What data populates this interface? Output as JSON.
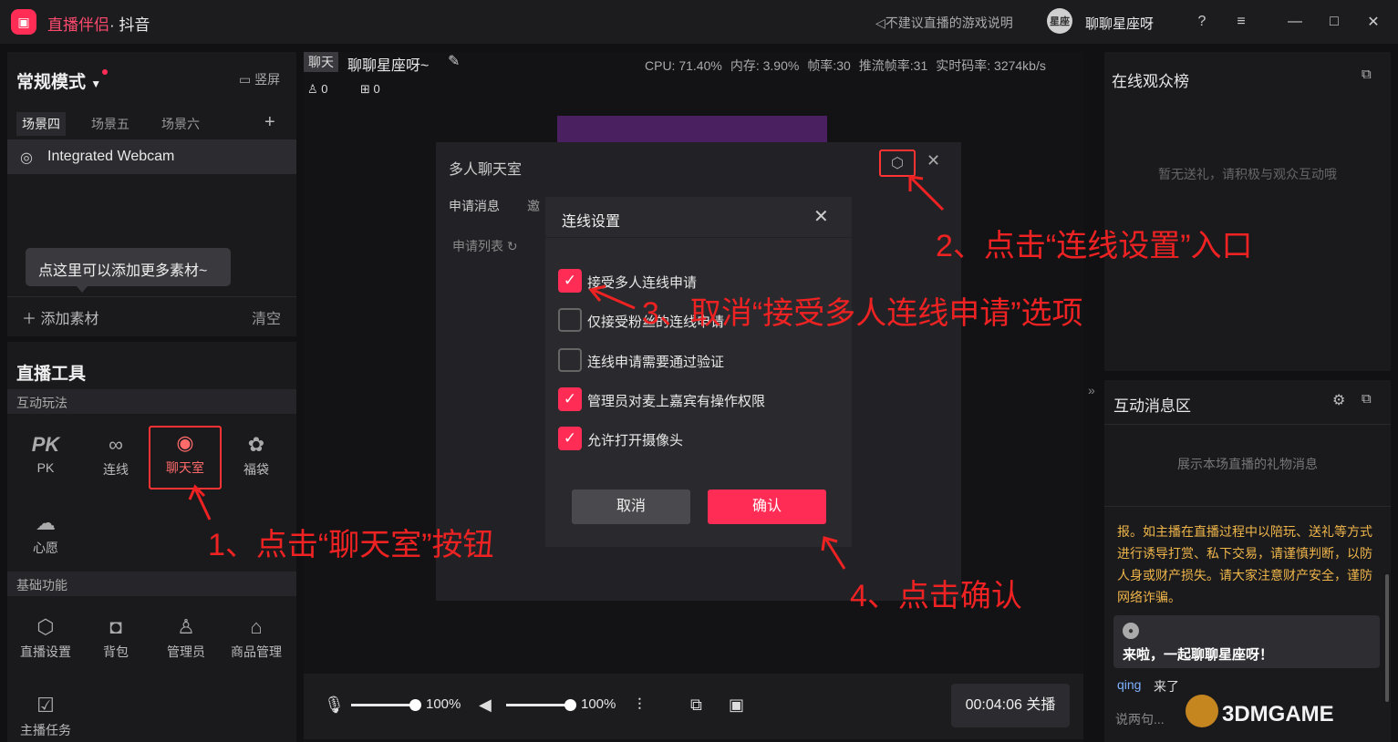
{
  "titlebar": {
    "app_name": "直播伴侣",
    "app_platform": "· 抖音",
    "game_note": "不建议直播的游戏说明",
    "user_name": "聊聊星座呀",
    "avatar_text": "星座"
  },
  "left": {
    "mode_title": "常规模式",
    "portrait_label": "竖屏",
    "scene_tabs": [
      "场景四",
      "场景五",
      "场景六"
    ],
    "source_label": "Integrated Webcam",
    "hint": "点这里可以添加更多素材~",
    "add_source": "添加素材",
    "clear_label": "清空",
    "tools_title": "直播工具",
    "section_interact": "互动玩法",
    "section_basic": "基础功能",
    "tools_interact": [
      {
        "label": "PK"
      },
      {
        "label": "连线"
      },
      {
        "label": "聊天室"
      },
      {
        "label": "福袋"
      },
      {
        "label": "心愿"
      }
    ],
    "tools_basic": [
      {
        "label": "直播设置"
      },
      {
        "label": "背包"
      },
      {
        "label": "管理员"
      },
      {
        "label": "商品管理"
      },
      {
        "label": "主播任务"
      }
    ]
  },
  "center": {
    "chat_tag": "聊天",
    "room_name": "聊聊星座呀~",
    "stats": {
      "cpu": "CPU: 71.40%",
      "mem": "内存: 3.90%",
      "fps": "帧率:30",
      "push_fps": "推流帧率:31",
      "bitrate": "实时码率: 3274kb/s"
    },
    "viewers": "0",
    "gifts": "0",
    "mic_volume": "100%",
    "speaker_volume": "100%",
    "mic_level": 1.0,
    "speaker_level": 1.0,
    "stop_label": "00:04:06 关播"
  },
  "room_dialog": {
    "title": "多人聊天室",
    "tab_apply": "申请消息",
    "tab_invite": "邀",
    "apply_list": "申请列表"
  },
  "settings_dialog": {
    "title": "连线设置",
    "options": [
      {
        "label": "接受多人连线申请",
        "checked": true
      },
      {
        "label": "仅接受粉丝的连线申请",
        "checked": false
      },
      {
        "label": "连线申请需要通过验证",
        "checked": false
      },
      {
        "label": "管理员对麦上嘉宾有操作权限",
        "checked": true
      },
      {
        "label": "允许打开摄像头",
        "checked": true
      }
    ],
    "cancel": "取消",
    "confirm": "确认"
  },
  "right": {
    "audience_title": "在线观众榜",
    "audience_empty": "暂无送礼，请积极与观众互动哦",
    "msg_title": "互动消息区",
    "msg_empty": "展示本场直播的礼物消息",
    "warning": "报。如主播在直播过程中以陪玩、送礼等方式进行诱导打赏、私下交易，请谨慎判断，以防人身或财产损失。请大家注意财产安全，谨防网络诈骗。",
    "welcome": "来啦，一起聊聊星座呀！",
    "join_name": "qing",
    "join_action": "来了",
    "say_placeholder": "说两句..."
  },
  "annotations": {
    "step1": "1、点击“聊天室”按钮",
    "step2": "2、点击“连线设置”入口",
    "step3": "3、取消“接受多人连线申请”选项",
    "step4": "4、点击确认"
  },
  "watermark": "3DMGAME",
  "colors": {
    "accent": "#ff2d55",
    "annotation": "#ee2222",
    "warning": "#f0b64a"
  }
}
